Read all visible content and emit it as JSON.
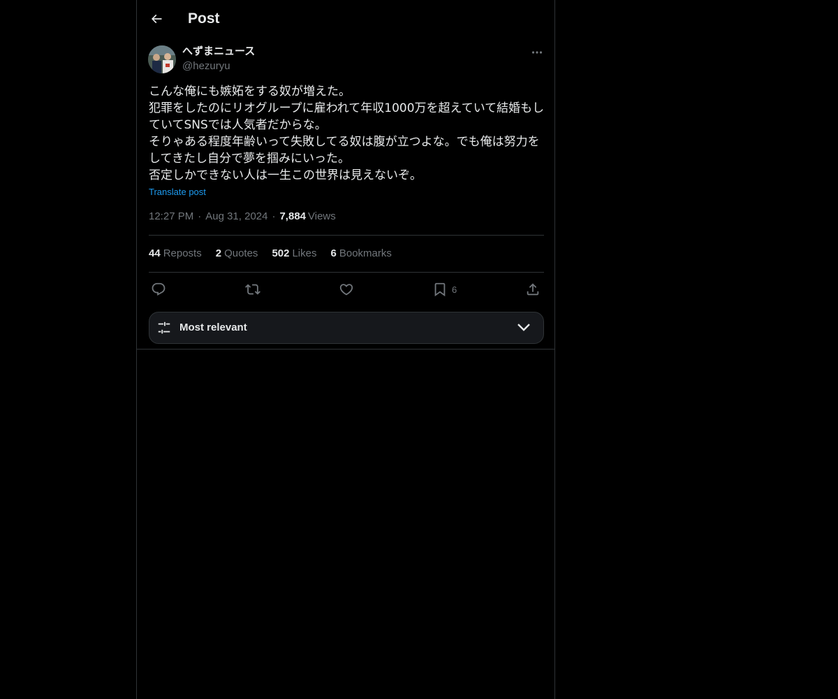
{
  "header": {
    "back_icon": "arrow-left-icon",
    "title": "Post"
  },
  "author": {
    "name": "へずまニュース",
    "handle": "@hezuryu"
  },
  "post": {
    "lines": [
      "こんな俺にも嫉妬をする奴が増えた。",
      "犯罪をしたのにリオグループに雇われて年収1000万を超えていて結婚もし",
      "ていてSNSでは人気者だからな。",
      "そりゃある程度年齢いって失敗してる奴は腹が立つよな。でも俺は努力を",
      "してきたし自分で夢を掴みにいった。",
      "否定しかできない人は一生この世界は見えないぞ。"
    ],
    "translate_label": "Translate post",
    "time": "12:27 PM",
    "date": "Aug 31, 2024",
    "views_count": "7,884",
    "views_label": "Views"
  },
  "stats": {
    "reposts_count": "44",
    "reposts_label": "Reposts",
    "quotes_count": "2",
    "quotes_label": "Quotes",
    "likes_count": "502",
    "likes_label": "Likes",
    "bookmarks_count": "6",
    "bookmarks_label": "Bookmarks"
  },
  "actions": {
    "reply_icon": "reply-icon",
    "repost_icon": "repost-icon",
    "like_icon": "heart-icon",
    "bookmark_icon": "bookmark-icon",
    "bookmark_count": "6",
    "share_icon": "share-icon"
  },
  "sort": {
    "label": "Most relevant",
    "icon": "sliders-icon",
    "chevron": "chevron-down-icon"
  },
  "colors": {
    "background": "#000000",
    "text": "#e7e9ea",
    "muted": "#71767b",
    "link": "#1d9bf0",
    "border": "#2f3336"
  }
}
